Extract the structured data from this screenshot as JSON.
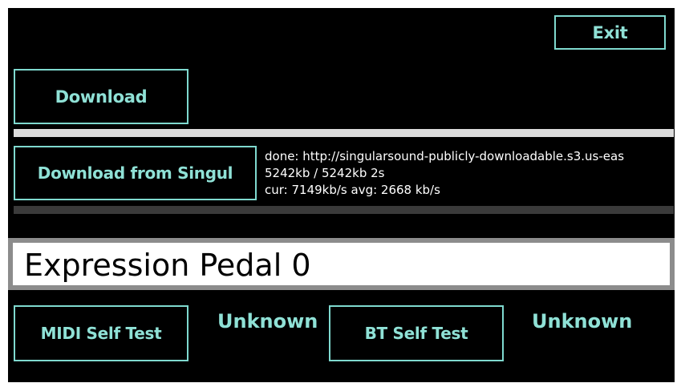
{
  "exit_label": "Exit",
  "download_label": "Download",
  "download_singular_label": "Download from Singul",
  "progress_top": 1.0,
  "progress_bottom": 1.0,
  "info": {
    "line1": "done: http://singularsound-publicly-downloadable.s3.us-eas",
    "line2": "5242kb / 5242kb 2s",
    "line3": "cur: 7149kb/s  avg: 2668 kb/s"
  },
  "expression_text": "Expression Pedal 0",
  "midi_test_label": "MIDI Self Test",
  "midi_status": "Unknown",
  "bt_test_label": "BT Self Test",
  "bt_status": "Unknown",
  "colors": {
    "accent": "#7fd9cf",
    "background": "#000000",
    "bar_light": "#dcdcdc",
    "bar_dark": "#3a3a3a"
  }
}
